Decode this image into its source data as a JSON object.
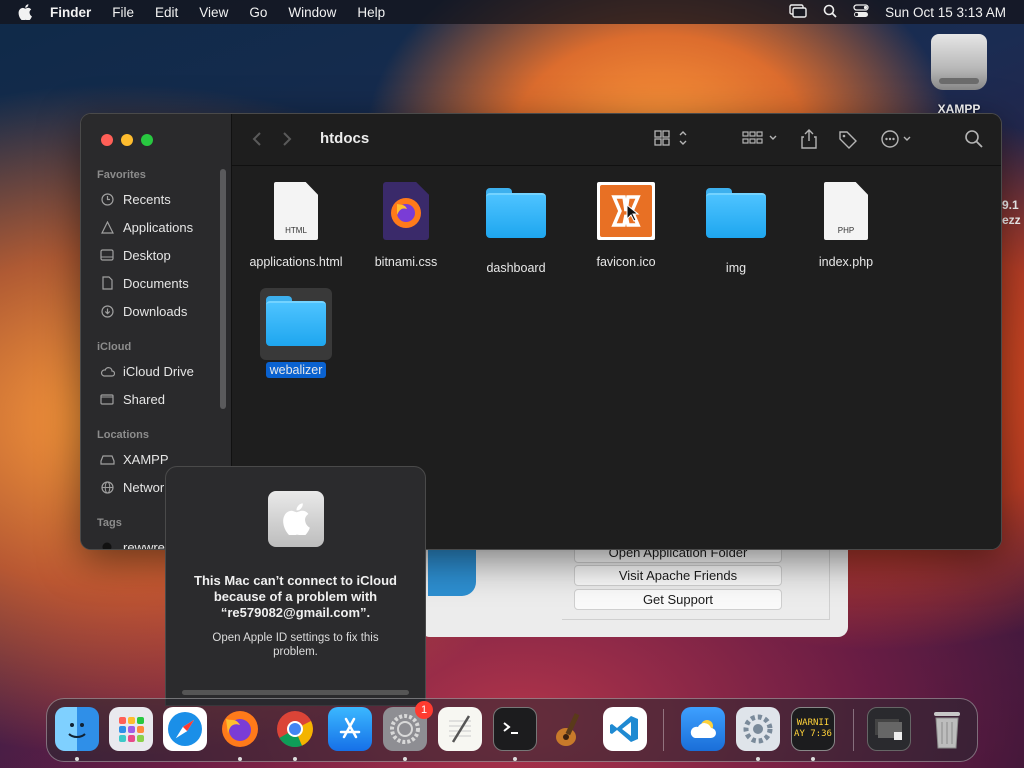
{
  "menubar": {
    "app": "Finder",
    "items": [
      "File",
      "Edit",
      "View",
      "Go",
      "Window",
      "Help"
    ],
    "clock": "Sun Oct 15  3:13 AM"
  },
  "desktop": {
    "disk_label": "XAMPP",
    "edge_text_1": "9.1",
    "edge_text_2": "ezz"
  },
  "finder": {
    "title": "htdocs",
    "sidebar": {
      "favorites_label": "Favorites",
      "favorites": [
        "Recents",
        "Applications",
        "Desktop",
        "Documents",
        "Downloads"
      ],
      "icloud_label": "iCloud",
      "icloud": [
        "iCloud Drive",
        "Shared"
      ],
      "locations_label": "Locations",
      "locations": [
        "XAMPP",
        "Network"
      ],
      "tags_label": "Tags",
      "tags": [
        "rewwre"
      ]
    },
    "files": [
      {
        "name": "applications.html",
        "kind": "html-doc",
        "ext": "HTML"
      },
      {
        "name": "bitnami.css",
        "kind": "firefox-doc"
      },
      {
        "name": "dashboard",
        "kind": "folder"
      },
      {
        "name": "favicon.ico",
        "kind": "xampp-ico"
      },
      {
        "name": "img",
        "kind": "folder"
      },
      {
        "name": "index.php",
        "kind": "php-doc",
        "ext": "PHP"
      },
      {
        "name": "webalizer",
        "kind": "folder",
        "selected": true
      }
    ]
  },
  "xampp_window": {
    "buttons": [
      "Open Application Folder",
      "Visit Apache Friends",
      "Get Support"
    ]
  },
  "alert": {
    "title": "This Mac can’t connect to iCloud because of a problem with “re579082@gmail.com”.",
    "message": "Open Apple ID settings to fix this problem."
  },
  "dock": {
    "apps": [
      "Finder",
      "Launchpad",
      "Safari",
      "Firefox",
      "Chrome",
      "App Store",
      "System Settings",
      "TextEdit",
      "Terminal",
      "GarageBand",
      "Visual Studio Code",
      "Weather",
      "XAMPP Manager",
      "Console",
      "Downloads Stack",
      "Trash"
    ],
    "settings_badge": "1",
    "console_text_1": "WARNII",
    "console_text_2": "AY 7:36"
  }
}
